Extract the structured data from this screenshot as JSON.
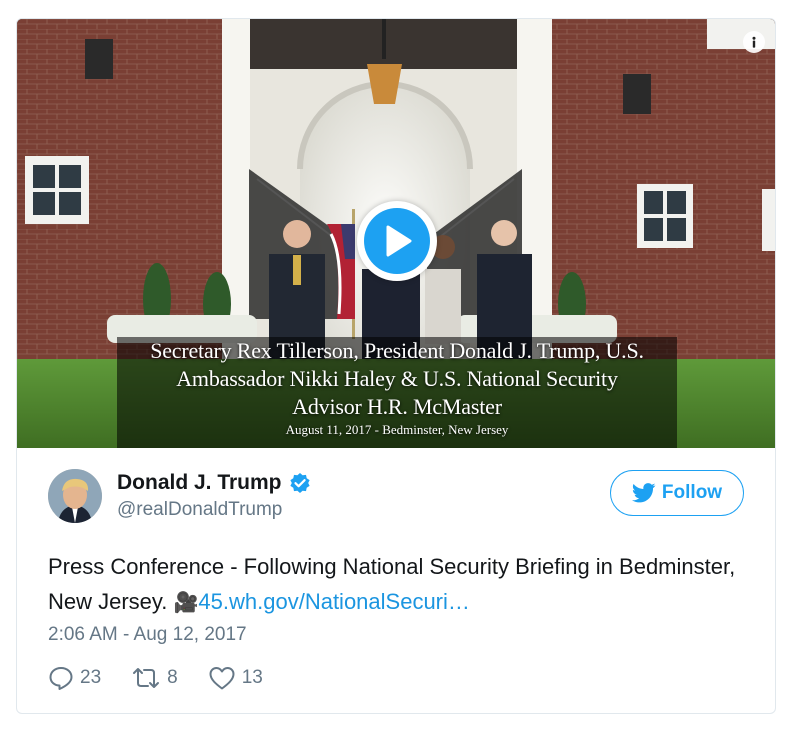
{
  "media": {
    "caption_lines": [
      "Secretary Rex Tillerson, President Donald J. Trump, U.S.",
      "Ambassador Nikki Haley & U.S. National Security",
      "Advisor H.R. McMaster"
    ],
    "caption_sub": "August 11, 2017 - Bedminster, New Jersey",
    "icons": {
      "info": "info-icon",
      "play": "play-icon"
    }
  },
  "tweet": {
    "author": {
      "display_name": "Donald J. Trump",
      "handle": "@realDonaldTrump",
      "verified": true
    },
    "follow_label": "Follow",
    "text": "Press Conference - Following National Security Briefing in Bedminster, New Jersey. ",
    "emoji": "🎥",
    "link_text": "45.wh.gov/NationalSecuri…",
    "timestamp": "2:06 AM - Aug 12, 2017",
    "reply_count": "23",
    "retweet_count": "8",
    "like_count": "13"
  },
  "colors": {
    "accent": "#1da1f2",
    "link": "#1b95e0",
    "muted": "#657786",
    "text": "#14171a",
    "border": "#e1e8ed"
  }
}
